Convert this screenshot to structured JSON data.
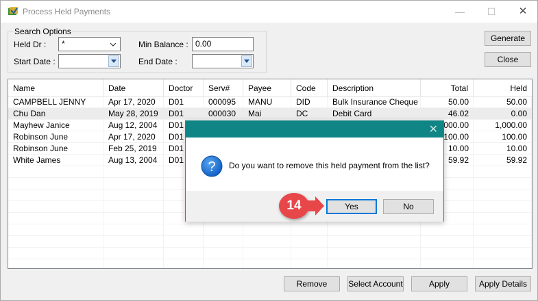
{
  "window": {
    "title": "Process Held Payments"
  },
  "search": {
    "group_label": "Search Options",
    "held_dr_label": "Held Dr :",
    "held_dr_value": "*",
    "min_balance_label": "Min Balance :",
    "min_balance_value": "0.00",
    "start_date_label": "Start Date :",
    "start_date_value": "",
    "end_date_label": "End Date :",
    "end_date_value": ""
  },
  "side_buttons": {
    "generate": "Generate",
    "close": "Close"
  },
  "table": {
    "columns": [
      "Name",
      "Date",
      "Doctor",
      "Serv#",
      "Payee",
      "Code",
      "Description",
      "Total",
      "Held"
    ],
    "rows": [
      [
        "CAMPBELL JENNY",
        "Apr 17, 2020",
        "D01",
        "000095",
        "MANU",
        "DID",
        "Bulk Insurance Cheque",
        "50.00",
        "50.00"
      ],
      [
        "Chu Dan",
        "May 28, 2019",
        "D01",
        "000030",
        "Mai",
        "DC",
        "Debit Card",
        "46.02",
        "0.00"
      ],
      [
        "Mayhew Janice",
        "Aug 12, 2004",
        "D01",
        "",
        "",
        "",
        "",
        "000.00",
        "1,000.00"
      ],
      [
        "Robinson June",
        "Apr 17, 2020",
        "D01",
        "",
        "",
        "",
        "",
        "100.00",
        "100.00"
      ],
      [
        "Robinson June",
        "Feb 25, 2019",
        "D01",
        "",
        "",
        "",
        "",
        "10.00",
        "10.00"
      ],
      [
        "White James",
        "Aug 13, 2004",
        "D01",
        "",
        "",
        "",
        "",
        "59.92",
        "59.92"
      ]
    ],
    "selected_row": 1
  },
  "bottom_buttons": {
    "remove": "Remove",
    "select_account": "Select Account",
    "apply": "Apply",
    "apply_details": "Apply Details"
  },
  "dialog": {
    "message": "Do you want to remove this held payment from the list?",
    "yes": "Yes",
    "no": "No",
    "icon": "question-icon"
  },
  "annotation": {
    "step_number": "14"
  },
  "colors": {
    "dialog_title": "#0f8585",
    "badge": "#e8474a",
    "focus": "#0078d7"
  }
}
